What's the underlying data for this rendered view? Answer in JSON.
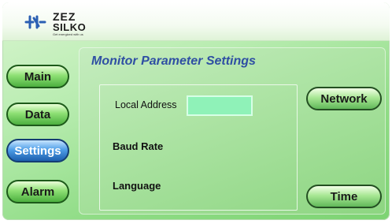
{
  "brand": {
    "name_top": "ZEZ",
    "name_bottom": "SILKO",
    "tagline": "Get energized with us"
  },
  "nav": {
    "items": [
      {
        "label": "Main"
      },
      {
        "label": "Data"
      },
      {
        "label": "Settings",
        "active": true
      },
      {
        "label": "Alarm"
      }
    ]
  },
  "panel": {
    "title": "Monitor Parameter Settings",
    "fields": {
      "local_address_label": "Local Address",
      "local_address_value": "",
      "baud_rate_label": "Baud Rate",
      "language_label": "Language"
    }
  },
  "buttons": {
    "network": "Network",
    "time": "Time"
  },
  "colors": {
    "accent_blue": "#2f4fa3",
    "active_button": "#4f9fe8",
    "input_fill": "#8ff2b8"
  }
}
